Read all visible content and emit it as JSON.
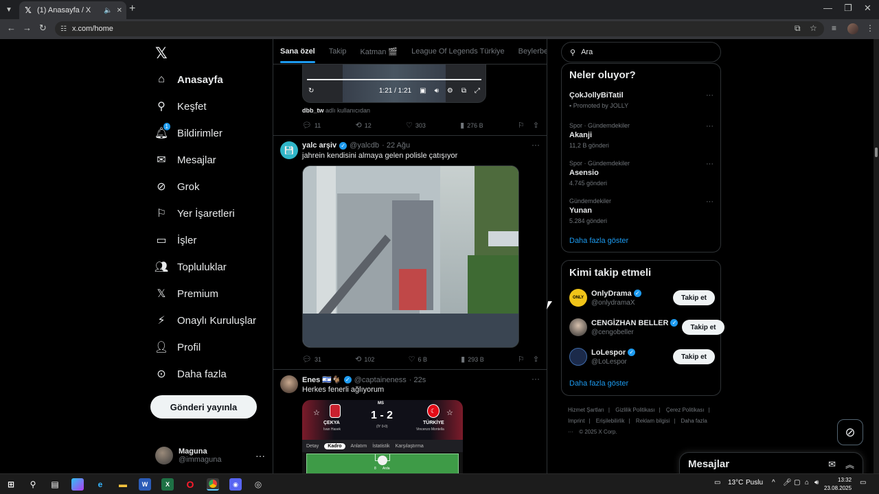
{
  "browser": {
    "tab_title": "(1) Anasayfa / X",
    "url": "x.com/home"
  },
  "nav": {
    "items": [
      {
        "label": "Anasayfa",
        "icon": "home-icon"
      },
      {
        "label": "Keşfet",
        "icon": "search-icon"
      },
      {
        "label": "Bildirimler",
        "icon": "bell-icon",
        "badge": "1"
      },
      {
        "label": "Mesajlar",
        "icon": "mail-icon"
      },
      {
        "label": "Grok",
        "icon": "grok-icon"
      },
      {
        "label": "Yer İşaretleri",
        "icon": "bookmark-icon"
      },
      {
        "label": "İşler",
        "icon": "briefcase-icon"
      },
      {
        "label": "Topluluklar",
        "icon": "people-icon"
      },
      {
        "label": "Premium",
        "icon": "x-logo-icon"
      },
      {
        "label": "Onaylı Kuruluşlar",
        "icon": "lightning-icon"
      },
      {
        "label": "Profil",
        "icon": "person-icon"
      },
      {
        "label": "Daha fazla",
        "icon": "more-circle-icon"
      }
    ],
    "post_button": "Gönderi yayınla",
    "account": {
      "name": "Maguna",
      "handle": "@immaguna"
    }
  },
  "feed": {
    "tabs": [
      "Sana özel",
      "Takip",
      "Katman 🎬",
      "League Of Legends Türkiye",
      "Beylerbeyli"
    ],
    "post1": {
      "time": "1:21 / 1:21",
      "attribution_user": "dbb_tw",
      "attribution_suffix": "adlı kullanıcıdan",
      "replies": "11",
      "reposts": "12",
      "likes": "303",
      "views": "276 B"
    },
    "post2": {
      "name": "yalc arşiv",
      "handle": "@yalcdb",
      "date": "· 22 Ağu",
      "text": "jahrein kendisini almaya gelen polisle çatışıyor",
      "replies": "31",
      "reposts": "102",
      "likes": "6 B",
      "views": "293 B"
    },
    "post3": {
      "name": "Enes 🇮🇱🐐",
      "handle": "@captaineness",
      "date": "· 22s",
      "text": "Herkes fenerli ağlıyorum",
      "match": {
        "league": "MS",
        "score": "1 - 2",
        "half": "(İY 0-0)",
        "home": "ÇEKYA",
        "home_coach": "Ivan Hasek",
        "away": "TÜRKİYE",
        "away_coach": "Vincenzo Montella",
        "tabs": [
          "Detay",
          "Kadro",
          "Anlatım",
          "İstatistik",
          "Karşılaştırma"
        ],
        "player_num": "8",
        "player_name": "Arda"
      }
    }
  },
  "sidebar": {
    "search_placeholder": "Ara",
    "trends_title": "Neler oluyor?",
    "promoted": {
      "name": "ÇokJollyBiTatil",
      "by": "Promoted by JOLLY"
    },
    "trends": [
      {
        "category": "Spor · Gündemdekiler",
        "name": "Akanji",
        "count": "11,2 B gönderi"
      },
      {
        "category": "Spor · Gündemdekiler",
        "name": "Asensio",
        "count": "4.745 gönderi"
      },
      {
        "category": "Gündemdekiler",
        "name": "Yunan",
        "count": "5.284 gönderi"
      }
    ],
    "trends_more": "Daha fazla göster",
    "who_title": "Kimi takip etmeli",
    "who": [
      {
        "name": "OnlyDrama",
        "handle": "@onlydramaX",
        "button": "Takip et"
      },
      {
        "name": "CENGİZHAN BELLER",
        "handle": "@cengobeller",
        "button": "Takip et"
      },
      {
        "name": "LoLespor",
        "handle": "@LoLespor",
        "button": "Takip et"
      }
    ],
    "who_more": "Daha fazla göster",
    "footer": [
      "Hizmet Şartları",
      "|",
      "Gizlilik Politikası",
      "|",
      "Çerez Politikası",
      "|",
      "Imprint",
      "|",
      "Erişilebilirlik",
      "|",
      "Reklam bilgisi",
      "|",
      "Daha fazla ···",
      "© 2025 X Corp."
    ],
    "messages_title": "Mesajlar"
  },
  "taskbar": {
    "weather": "13°C",
    "weather_desc": "Puslu",
    "time": "13:32",
    "date": "23.08.2025"
  }
}
